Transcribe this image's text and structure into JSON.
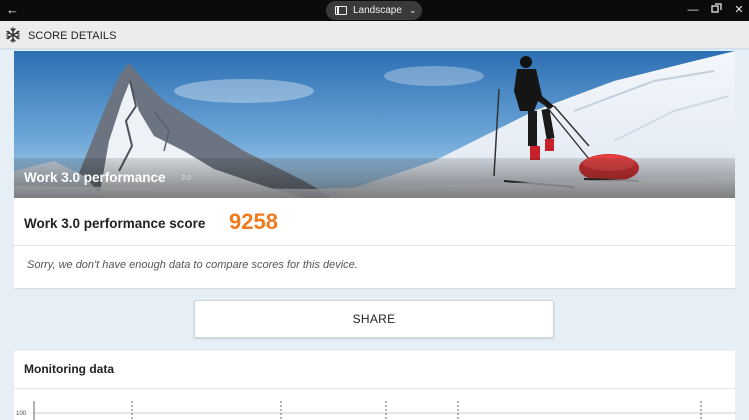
{
  "titlebar": {
    "orientation_label": "Landscape"
  },
  "appbar": {
    "title": "SCORE DETAILS"
  },
  "hero": {
    "banner_title": "Work 3.0 performance",
    "banner_version": "3.0"
  },
  "score": {
    "label": "Work 3.0 performance score",
    "value": "9258",
    "compare_message": "Sorry, we don't have enough data to compare scores for this device.",
    "accent_color": "#f07a1e"
  },
  "share": {
    "label": "SHARE"
  },
  "monitoring": {
    "title": "Monitoring data",
    "y_tick_top": "100"
  }
}
